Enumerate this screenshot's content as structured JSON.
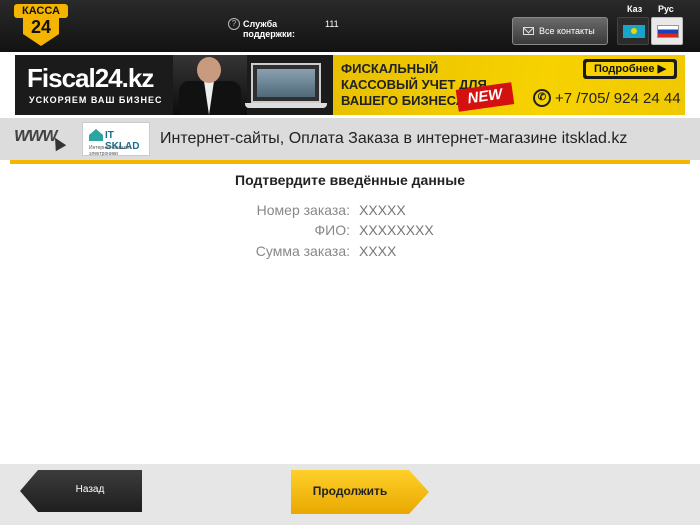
{
  "header": {
    "logo_top": "КАССА",
    "logo_number": "24",
    "support_label": "Служба поддержки:",
    "support_number": "111",
    "contacts_button": "Все контакты",
    "languages": [
      "Каз",
      "Рус"
    ]
  },
  "banner": {
    "brand": "Fiscal24.kz",
    "slogan": "УСКОРЯЕМ ВАШ БИЗНЕС",
    "promo": "ФИСКАЛЬНЫЙ КАССОВЫЙ УЧЕТ ДЛЯ ВАШЕГО БИЗНЕСА",
    "new_badge": "NEW",
    "more_button": "Подробнее ▶",
    "phone": "+7 /705/ 924 24 44"
  },
  "service": {
    "www_icon_text": "WWW",
    "provider_logo_name": "IT SKLAD",
    "provider_logo_tag": "Интернет-магазин электроники",
    "title": "Интернет-сайты, Оплата Заказа в интернет-магазине itsklad.kz"
  },
  "confirm": {
    "title": "Подтвердите введённые данные",
    "fields": [
      {
        "label": "Номер заказа:",
        "value": "XXXXX"
      },
      {
        "label": "ФИО:",
        "value": "XXXXXXXX"
      },
      {
        "label": "Сумма заказа:",
        "value": "XXXX"
      }
    ]
  },
  "footer": {
    "back_button": "Назад",
    "continue_button": "Продолжить"
  },
  "colors": {
    "accent": "#f4b400",
    "header_bg": "#1a1a1a",
    "strip_bg": "#dcdcdc"
  }
}
